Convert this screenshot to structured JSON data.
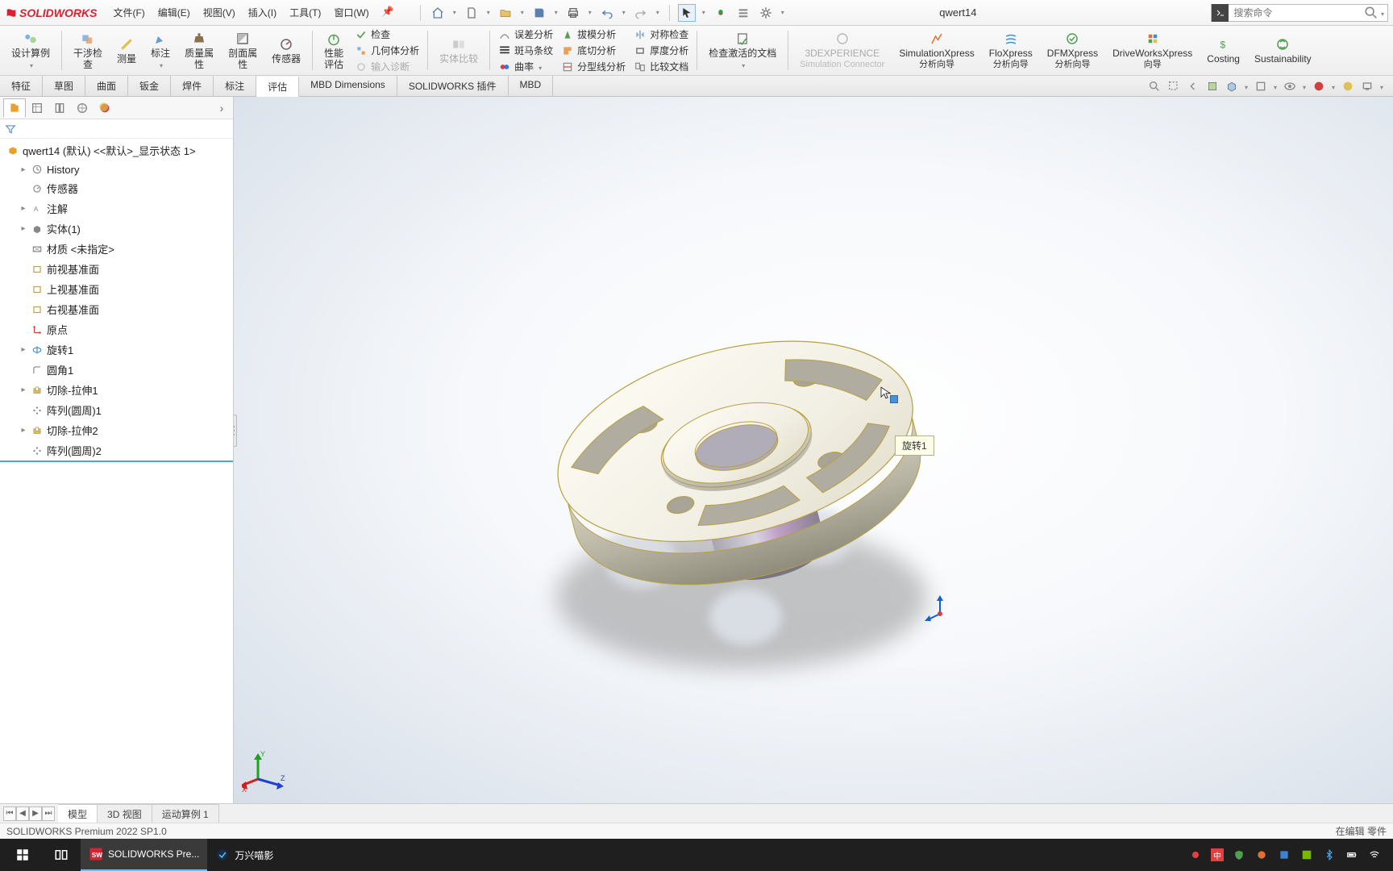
{
  "app": {
    "brand": "SOLIDWORKS",
    "doc_title": "qwert14",
    "search_placeholder": "搜索命令"
  },
  "menus": [
    "文件(F)",
    "编辑(E)",
    "视图(V)",
    "插入(I)",
    "工具(T)",
    "窗口(W)"
  ],
  "ribbon_big": [
    {
      "id": "design-study",
      "label": "设计算例"
    },
    {
      "id": "interference",
      "label": "干涉检\n查"
    },
    {
      "id": "measure",
      "label": "测量"
    },
    {
      "id": "markup",
      "label": "标注"
    },
    {
      "id": "mass-props",
      "label": "质量属\n性"
    },
    {
      "id": "section-props",
      "label": "剖面属\n性"
    },
    {
      "id": "sensor",
      "label": "传感器"
    },
    {
      "id": "perf-eval",
      "label": "性能\n评估"
    }
  ],
  "ribbon_check_col": [
    {
      "id": "check",
      "label": "检查"
    },
    {
      "id": "geom-analysis",
      "label": "几何体分析"
    },
    {
      "id": "import-diag",
      "label": "输入诊断",
      "disabled": true
    }
  ],
  "ribbon_compare": {
    "id": "body-compare",
    "label": "实体比较",
    "disabled": true
  },
  "ribbon_analysis_cols": [
    [
      {
        "id": "deviation",
        "label": "误差分析"
      },
      {
        "id": "zebra",
        "label": "斑马条纹"
      },
      {
        "id": "curvature",
        "label": "曲率"
      }
    ],
    [
      {
        "id": "draft",
        "label": "拔模分析"
      },
      {
        "id": "undercut",
        "label": "底切分析"
      },
      {
        "id": "parting-line",
        "label": "分型线分析"
      }
    ],
    [
      {
        "id": "symmetry",
        "label": "对称检查"
      },
      {
        "id": "thickness",
        "label": "厚度分析"
      },
      {
        "id": "compare-doc",
        "label": "比较文档"
      }
    ]
  ],
  "ribbon_activate_doc": {
    "id": "activate-docs",
    "label": "检查激活的文档"
  },
  "ribbon_right": [
    {
      "id": "3dexperience",
      "label": "3DEXPERIENCE",
      "sub": "Simulation Connector",
      "disabled": true
    },
    {
      "id": "simxpress",
      "label": "SimulationXpress",
      "sub": "分析向导"
    },
    {
      "id": "floxpress",
      "label": "FloXpress",
      "sub": "分析向导"
    },
    {
      "id": "dfmxpress",
      "label": "DFMXpress",
      "sub": "分析向导"
    },
    {
      "id": "driveworks",
      "label": "DriveWorksXpress",
      "sub": "向导"
    },
    {
      "id": "costing",
      "label": "Costing",
      "sub": ""
    },
    {
      "id": "sustainability",
      "label": "Sustainability",
      "sub": ""
    }
  ],
  "tabs": [
    "特征",
    "草图",
    "曲面",
    "钣金",
    "焊件",
    "标注",
    "评估",
    "MBD Dimensions",
    "SOLIDWORKS 插件",
    "MBD"
  ],
  "active_tab": "评估",
  "tree_root": "qwert14 (默认) <<默认>_显示状态 1>",
  "tree": [
    {
      "id": "history",
      "label": "History",
      "exp": true
    },
    {
      "id": "sensors",
      "label": "传感器"
    },
    {
      "id": "annotations",
      "label": "注解",
      "exp": true
    },
    {
      "id": "solid-bodies",
      "label": "实体(1)",
      "exp": true
    },
    {
      "id": "material",
      "label": "材质 <未指定>"
    },
    {
      "id": "front-plane",
      "label": "前视基准面"
    },
    {
      "id": "top-plane",
      "label": "上视基准面"
    },
    {
      "id": "right-plane",
      "label": "右视基准面"
    },
    {
      "id": "origin",
      "label": "原点"
    },
    {
      "id": "revolve1",
      "label": "旋转1",
      "exp": true
    },
    {
      "id": "fillet1",
      "label": "圆角1"
    },
    {
      "id": "cut-ext1",
      "label": "切除-拉伸1",
      "exp": true
    },
    {
      "id": "pattern1",
      "label": "阵列(圆周)1"
    },
    {
      "id": "cut-ext2",
      "label": "切除-拉伸2",
      "exp": true
    },
    {
      "id": "pattern2",
      "label": "阵列(圆周)2"
    }
  ],
  "hover_tip": "旋转1",
  "bottom_tabs": [
    "模型",
    "3D 视图",
    "运动算例 1"
  ],
  "active_bottom_tab": "模型",
  "status": {
    "version": "SOLIDWORKS Premium 2022 SP1.0",
    "mode": "在编辑 零件"
  },
  "taskbar": {
    "apps": [
      {
        "id": "solidworks",
        "label": "SOLIDWORKS Pre...",
        "active": true
      },
      {
        "id": "wanxing",
        "label": "万兴喵影"
      }
    ]
  }
}
